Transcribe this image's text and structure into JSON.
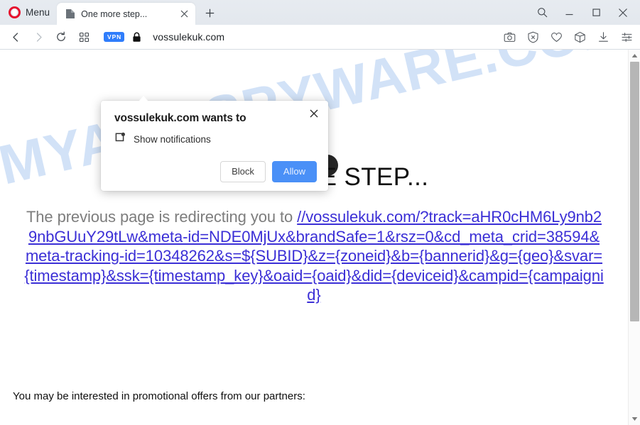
{
  "browser": {
    "menu_label": "Menu",
    "tab": {
      "title": "One more step...",
      "favicon": "page-icon",
      "close": "×"
    },
    "new_tab": "+",
    "window_controls": {
      "search": "search-icon",
      "minimize": "minimize-icon",
      "maximize": "maximize-icon",
      "close": "close-icon"
    },
    "address_bar": {
      "back": "back-arrow-icon",
      "forward": "forward-arrow-icon",
      "reload": "reload-icon",
      "tab_overview": "grid-icon",
      "vpn_badge": "VPN",
      "lock": "padlock-icon",
      "url": "vossulekuk.com"
    },
    "page_actions": [
      {
        "name": "snapshot-icon",
        "label": "Snapshot"
      },
      {
        "name": "ad-blocker-icon",
        "label": "Ad blocker"
      },
      {
        "name": "heart-icon",
        "label": "Add to favorites"
      },
      {
        "name": "crypto-wallet-icon",
        "label": "Crypto wallet"
      },
      {
        "name": "downloads-icon",
        "label": "Downloads"
      },
      {
        "name": "easy-setup-icon",
        "label": "Easy setup"
      }
    ]
  },
  "dialog": {
    "title": "vossulekuk.com wants to",
    "permission_icon": "notification-bell-icon",
    "permission_label": "Show notifications",
    "block_label": "Block",
    "allow_label": "Allow",
    "close_label": "✕",
    "allow_color": "#4a90f7"
  },
  "page": {
    "heading": "ONE MORE STEP...",
    "redirect_prefix": "The previous page is redirecting you to ",
    "redirect_url": "//vossulekuk.com/?track=aHR0cHM6Ly9nb29nbGUuY29tLw&meta-id=NDE0MjUx&brandSafe=1&rsz=0&cd_meta_crid=38594&meta-tracking-id=10348262&s=${SUBID}&z={zoneid}&b={bannerid}&g={geo}&svar={timestamp}&ssk={timestamp_key}&oaid={oaid}&did={deviceid}&campid={campaignid}",
    "link_color": "#3b2fd6",
    "partners_text": "You may be interested in promotional offers from our partners:",
    "watermark": "MYANTISPYWARE.COM"
  }
}
